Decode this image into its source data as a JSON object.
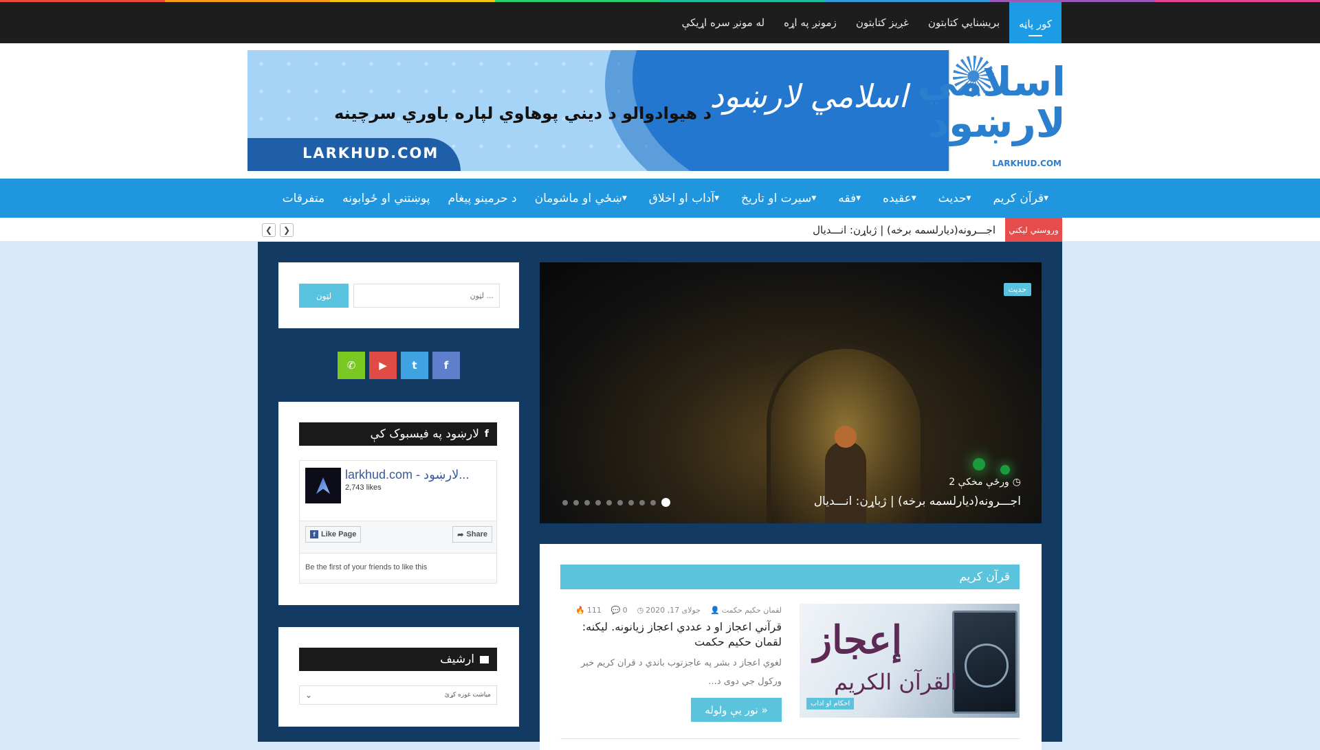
{
  "stripe_colors": [
    "#e74c3c",
    "#f39c12",
    "#f1c40f",
    "#2ecc71",
    "#1abc9c",
    "#3498db",
    "#9b59b6",
    "#e84393"
  ],
  "topbar": {
    "items": [
      {
        "label": "کور پاڼه",
        "active": true
      },
      {
        "label": "بریښنایي کتابتون"
      },
      {
        "label": "غږیز کتابتون"
      },
      {
        "label": "زمونږ په اړه"
      },
      {
        "label": "له مونږ سره اړیکې"
      }
    ]
  },
  "banner": {
    "calligraphy": "اسلامي لارښود",
    "tagline": "د هيوادوالو د ديني پوهاوي لپاره باوري سرچينه",
    "domain": "LARKHUD.COM",
    "logo_text": "اسلامي لارښود",
    "logo_sub": "LARKHUD.COM"
  },
  "mainnav": {
    "items": [
      {
        "label": "قرآن کريم",
        "has_dropdown": true
      },
      {
        "label": "حديث",
        "has_dropdown": true
      },
      {
        "label": "عقيده",
        "has_dropdown": true
      },
      {
        "label": "فقه",
        "has_dropdown": true
      },
      {
        "label": "سيرت او تاريخ",
        "has_dropdown": true
      },
      {
        "label": "آداب او اخلاق",
        "has_dropdown": true
      },
      {
        "label": "ښځي او ماشومان",
        "has_dropdown": true
      },
      {
        "label": "د حرمينو پيغام",
        "has_dropdown": false
      },
      {
        "label": "پوښتني او ځوابونه",
        "has_dropdown": false
      },
      {
        "label": "متفرقات",
        "has_dropdown": false
      }
    ]
  },
  "ticker": {
    "label": "وروستي ليکني",
    "text": "اجـــرونه(ديارلسمه برخه) | ژباړن: انـــديال",
    "prev_icon": "chevron-left-icon",
    "next_icon": "chevron-right-icon"
  },
  "slider": {
    "category": "حديث",
    "meta": "2 ورځې مخکې",
    "title": "اجـــرونه(ديارلسمه برخه) | ژباړن: انـــديال",
    "slide_count": 10,
    "active_slide": 10
  },
  "search": {
    "placeholder": "لټون ...",
    "button": "لټون"
  },
  "social": [
    {
      "icon": "facebook-icon",
      "glyph": "f",
      "color": "#5d7fcc"
    },
    {
      "icon": "twitter-icon",
      "glyph": "t",
      "color": "#3fa3e2"
    },
    {
      "icon": "youtube-icon",
      "glyph": "▶",
      "color": "#e14b45"
    },
    {
      "icon": "whatsapp-icon",
      "glyph": "✆",
      "color": "#7ac923"
    }
  ],
  "facebook_widget": {
    "heading": "لارښود په فيسبوک کې",
    "page_name": "larkhud.com - لارښود...",
    "likes": "2,743 likes",
    "like_button": "Like Page",
    "share_button": "Share",
    "friends_text": "Be the first of your friends to like this"
  },
  "archive": {
    "heading": "ارشيف",
    "select_value": "مياشت غوره کړئ"
  },
  "section": {
    "heading": "قرآن کريم"
  },
  "post": {
    "thumb_calligraphy": "إعجاز",
    "thumb_calligraphy_2": "القرآن الكريم",
    "tag": "احکام او اداب",
    "author": "لقمان حکيم حکمت",
    "date": "جولای 17, 2020",
    "comments": "0",
    "views": "111",
    "title": "قرآني اعجاز او د عددي اعجاز زيانونه. ليکنه: لقمان حکيم حکمت",
    "excerpt": "لغوي اعجاز د بشر په عاجزتوب باندي د قران کريم خبر ورکول جي دوی د...",
    "read_more": "نور يې ولوله »"
  }
}
